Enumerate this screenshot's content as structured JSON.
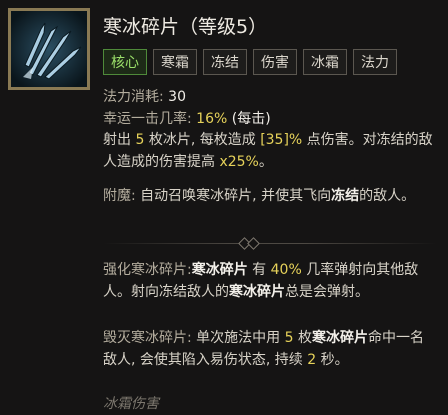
{
  "skill": {
    "icon_name": "frost-shards-icon",
    "title": "寒冰碎片（等级5）",
    "tags": [
      "核心",
      "寒霜",
      "冻结",
      "伤害",
      "冰霜",
      "法力"
    ]
  },
  "stats": {
    "mana_cost_label": "法力消耗:",
    "mana_cost_value": "30",
    "luck_label": "幸运一击几率:",
    "luck_value": "16%",
    "luck_suffix": "(每击)"
  },
  "description": {
    "p1_a": "射出 ",
    "p1_count": "5",
    "p1_b": " 枚冰片, 每枚造成 ",
    "p1_dmg": "[35]%",
    "p1_c": " 点伤害。对冻结的敌人造成的伤害提高 ",
    "p1_bonus": "x25%",
    "p1_d": "。",
    "enchant_label": "附魔:",
    "enchant_a": " 自动召唤寒冰碎片, 并使其飞向",
    "enchant_bold": "冻结",
    "enchant_b": "的敌人。"
  },
  "upgrades": {
    "u1_label": "强化寒冰碎片:",
    "u1_name": "寒冰碎片",
    "u1_a": " 有 ",
    "u1_pct": "40%",
    "u1_b": " 几率弹射向其他敌人。射向冻结敌人的",
    "u1_name2": "寒冰碎片",
    "u1_c": "总是会弹射。",
    "u2_label": "毁灭寒冰碎片:",
    "u2_a": " 单次施法中用 ",
    "u2_count": "5",
    "u2_b": " 枚",
    "u2_name": "寒冰碎片",
    "u2_c": "命中一名敌人, 会使其陷入易伤状态, 持续 ",
    "u2_dur": "2",
    "u2_d": " 秒。"
  },
  "footer": "冰霜伤害",
  "colors": {
    "core_tag": "#9be06a",
    "highlight": "#e6d25a",
    "frame": "#8a7a54"
  }
}
